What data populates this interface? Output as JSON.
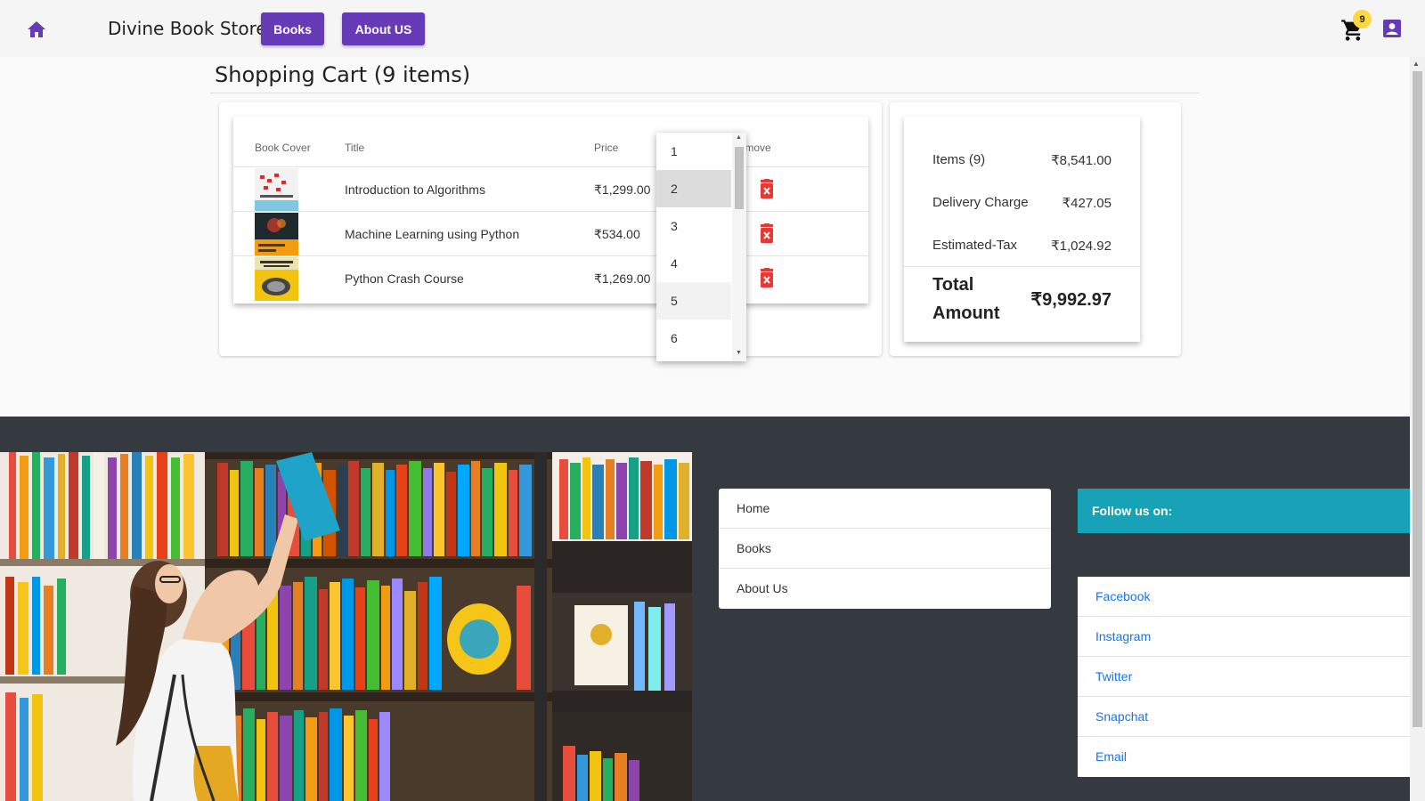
{
  "header": {
    "brand": "Divine Book Store",
    "nav": {
      "books": "Books",
      "about": "About US"
    },
    "cart_count": "9"
  },
  "cart": {
    "title": "Shopping Cart (9 items)",
    "columns": {
      "cover": "Book Cover",
      "title": "Title",
      "price": "Price",
      "remove": "Remove"
    },
    "rows": [
      {
        "title": "Introduction to Algorithms",
        "price": "₹1,299.00"
      },
      {
        "title": "Machine Learning using Python",
        "price": "₹534.00"
      },
      {
        "title": "Python Crash Course",
        "price": "₹1,269.00"
      }
    ]
  },
  "quantity_dropdown": {
    "options": [
      "1",
      "2",
      "3",
      "4",
      "5",
      "6"
    ],
    "selected": "2",
    "hovered": "5"
  },
  "summary": {
    "items_label": "Items (9)",
    "items_value": "₹8,541.00",
    "delivery_label": "Delivery Charge",
    "delivery_value": "₹427.05",
    "tax_label": "Estimated-Tax",
    "tax_value": "₹1,024.92",
    "total_label": "Total Amount",
    "total_value": "₹9,992.97"
  },
  "footer": {
    "links": [
      "Home",
      "Books",
      "About Us"
    ],
    "follow_title": "Follow us on:",
    "social": [
      "Facebook",
      "Instagram",
      "Twitter",
      "Snapchat",
      "Email"
    ]
  },
  "colors": {
    "primary": "#673ab7",
    "badge": "#ffd740",
    "danger": "#e53935",
    "footer_bg": "#343a40",
    "follow_bg": "#17a2b8",
    "link": "#1a73e8"
  }
}
